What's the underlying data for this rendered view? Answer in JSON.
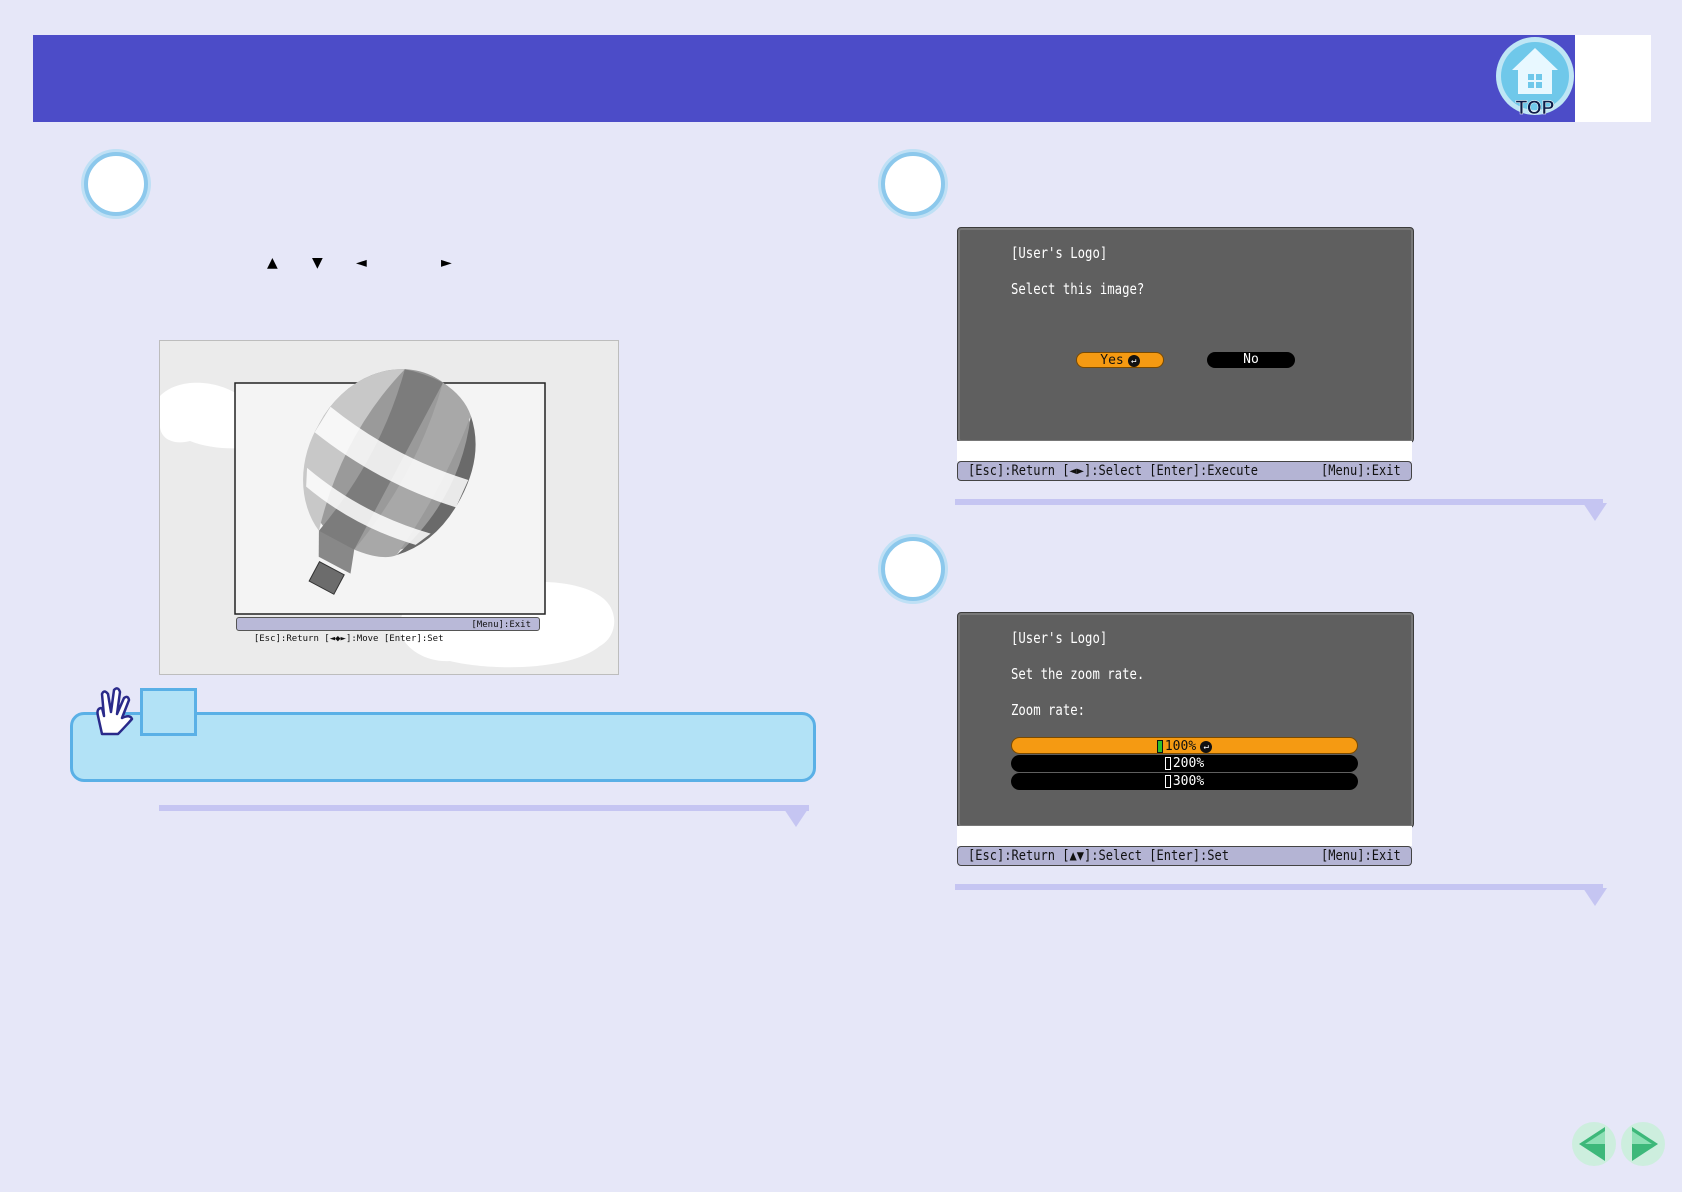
{
  "header": {
    "top_label": "TOP"
  },
  "left_column": {
    "keys": {
      "up": "▲",
      "down": "▼",
      "left": "◄",
      "right": "►"
    },
    "balloon_screen": {
      "help_left": "[Esc]:Return [◄◆►]:Move [Enter]:Set",
      "help_right": "[Menu]:Exit"
    }
  },
  "dialog_select": {
    "title": "[User's Logo]",
    "message": "Select this image?",
    "yes_label": "Yes",
    "no_label": "No",
    "enter_icon": "↵",
    "help_left": "[Esc]:Return [◄►]:Select [Enter]:Execute",
    "help_right": "[Menu]:Exit"
  },
  "dialog_zoom": {
    "title": "[User's Logo]",
    "message": "Set the zoom rate.",
    "zoom_label": "Zoom rate:",
    "options": [
      "100%",
      "200%",
      "300%"
    ],
    "selected_index": 0,
    "enter_icon": "↵",
    "help_left": "[Esc]:Return [▲▼]:Select [Enter]:Set",
    "help_right": "[Menu]:Exit"
  },
  "colors": {
    "header": "#4c4cc8",
    "page_background": "#e6e7f8",
    "menu_panel": "#5f5f5f",
    "highlight": "#f59a12",
    "tip_background": "#b2e2f6"
  },
  "icons": [
    "top-home-icon",
    "pointing-hand-icon",
    "previous-page-icon",
    "next-page-icon",
    "enter-key-icon"
  ]
}
